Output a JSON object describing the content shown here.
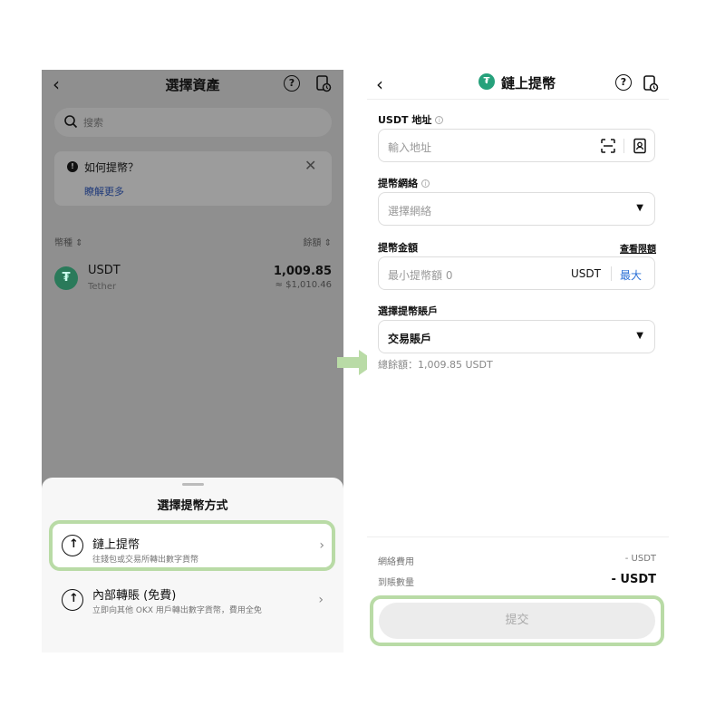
{
  "left": {
    "title": "選擇資產",
    "search_placeholder": "搜索",
    "info_card": {
      "title": "如何提幣？",
      "link": "瞭解更多"
    },
    "columns": {
      "currency": "幣種 ⇕",
      "balance": "餘額 ⇕"
    },
    "asset": {
      "symbol": "USDT",
      "name": "Tether",
      "amount": "1,009.85",
      "fiat": "≈ $1,010.46"
    },
    "sheet": {
      "title": "選擇提幣方式",
      "options": [
        {
          "title": "鏈上提幣",
          "subtitle": "往錢包或交易所轉出數字貨幣"
        },
        {
          "title": "內部轉賬 (免費)",
          "subtitle": "立即向其他 OKX 用戶轉出數字貨幣，費用全免"
        }
      ]
    }
  },
  "right": {
    "title": "鏈上提幣",
    "address": {
      "label": "USDT 地址",
      "placeholder": "輸入地址"
    },
    "network": {
      "label": "提幣網絡",
      "placeholder": "選擇網絡"
    },
    "amount": {
      "label": "提幣金額",
      "limit_link": "查看限額",
      "placeholder": "最小提幣額 0",
      "unit": "USDT",
      "max": "最大"
    },
    "account": {
      "label": "選擇提幣賬戶",
      "value": "交易賬戶"
    },
    "balance_text": "總餘額：1,009.85 USDT",
    "fee": {
      "label": "網絡費用",
      "value": "- USDT"
    },
    "receive": {
      "label": "到賬數量",
      "value": "- USDT"
    },
    "submit_label": "提交"
  },
  "colors": {
    "highlight": "#b9dba6",
    "tether_green": "#26a17b",
    "link_blue": "#2a6fd6",
    "overlay_gray": "#8f8f8f"
  },
  "icons": [
    "back-icon",
    "help-icon",
    "history-icon",
    "search-icon",
    "info-icon",
    "close-icon",
    "tether-icon",
    "upload-icon",
    "chevron-right-icon",
    "scan-icon",
    "address-book-icon",
    "caret-down-icon",
    "flow-arrow-icon"
  ]
}
